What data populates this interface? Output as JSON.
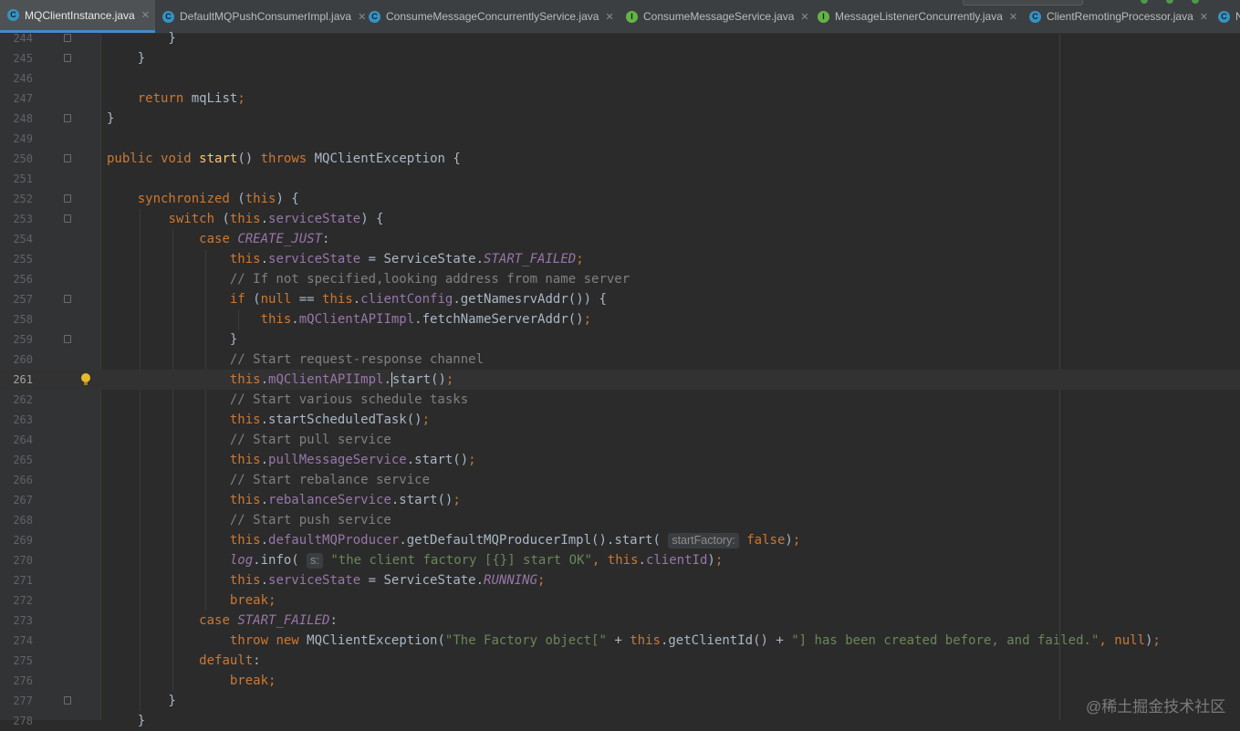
{
  "tabs": [
    {
      "label": "MQClientInstance.java",
      "kind": "C",
      "active": true
    },
    {
      "label": "DefaultMQPushConsumerImpl.java",
      "kind": "C"
    },
    {
      "label": "ConsumeMessageConcurrentlyService.java",
      "kind": "C"
    },
    {
      "label": "ConsumeMessageService.java",
      "kind": "I"
    },
    {
      "label": "MessageListenerConcurrently.java",
      "kind": "I"
    },
    {
      "label": "ClientRemotingProcessor.java",
      "kind": "C"
    },
    {
      "label": "N",
      "kind": "C"
    }
  ],
  "editor": {
    "current_line": 261,
    "lines": [
      {
        "n": "244",
        "code": "        }"
      },
      {
        "n": "245",
        "code": "    }"
      },
      {
        "n": "246",
        "code": ""
      },
      {
        "n": "247",
        "code": "    return mqList;"
      },
      {
        "n": "248",
        "code": "}"
      },
      {
        "n": "249",
        "code": ""
      },
      {
        "n": "250",
        "code": "public void start() throws MQClientException {"
      },
      {
        "n": "251",
        "code": ""
      },
      {
        "n": "252",
        "code": "    synchronized (this) {"
      },
      {
        "n": "253",
        "code": "        switch (this.serviceState) {"
      },
      {
        "n": "254",
        "code": "            case CREATE_JUST:"
      },
      {
        "n": "255",
        "code": "                this.serviceState = ServiceState.START_FAILED;"
      },
      {
        "n": "256",
        "code": "                // If not specified,looking address from name server"
      },
      {
        "n": "257",
        "code": "                if (null == this.clientConfig.getNamesrvAddr()) {"
      },
      {
        "n": "258",
        "code": "                    this.mQClientAPIImpl.fetchNameServerAddr();"
      },
      {
        "n": "259",
        "code": "                }"
      },
      {
        "n": "260",
        "code": "                // Start request-response channel"
      },
      {
        "n": "261",
        "code": "                this.mQClientAPIImpl.start();"
      },
      {
        "n": "262",
        "code": "                // Start various schedule tasks"
      },
      {
        "n": "263",
        "code": "                this.startScheduledTask();"
      },
      {
        "n": "264",
        "code": "                // Start pull service"
      },
      {
        "n": "265",
        "code": "                this.pullMessageService.start();"
      },
      {
        "n": "266",
        "code": "                // Start rebalance service"
      },
      {
        "n": "267",
        "code": "                this.rebalanceService.start();"
      },
      {
        "n": "268",
        "code": "                // Start push service"
      },
      {
        "n": "269",
        "code": "                this.defaultMQProducer.getDefaultMQProducerImpl().start( startFactory: false);"
      },
      {
        "n": "270",
        "code": "                log.info( s: \"the client factory [{}] start OK\", this.clientId);"
      },
      {
        "n": "271",
        "code": "                this.serviceState = ServiceState.RUNNING;"
      },
      {
        "n": "272",
        "code": "                break;"
      },
      {
        "n": "273",
        "code": "            case START_FAILED:"
      },
      {
        "n": "274",
        "code": "                throw new MQClientException(\"The Factory object[\" + this.getClientId() + \"] has been created before, and failed.\", null);"
      },
      {
        "n": "275",
        "code": "            default:"
      },
      {
        "n": "276",
        "code": "                break;"
      },
      {
        "n": "277",
        "code": "        }"
      },
      {
        "n": "278",
        "code": "    }"
      }
    ]
  },
  "watermark": "@稀土掘金技术社区",
  "colors": {
    "background": "#2b2b2b",
    "gutter": "#313335",
    "keyword": "#cc7832",
    "field": "#9876aa",
    "method": "#ffc66d",
    "string": "#6a8759",
    "comment": "#808080",
    "text": "#a9b7c6",
    "tab_active_underline": "#4a88c7"
  }
}
